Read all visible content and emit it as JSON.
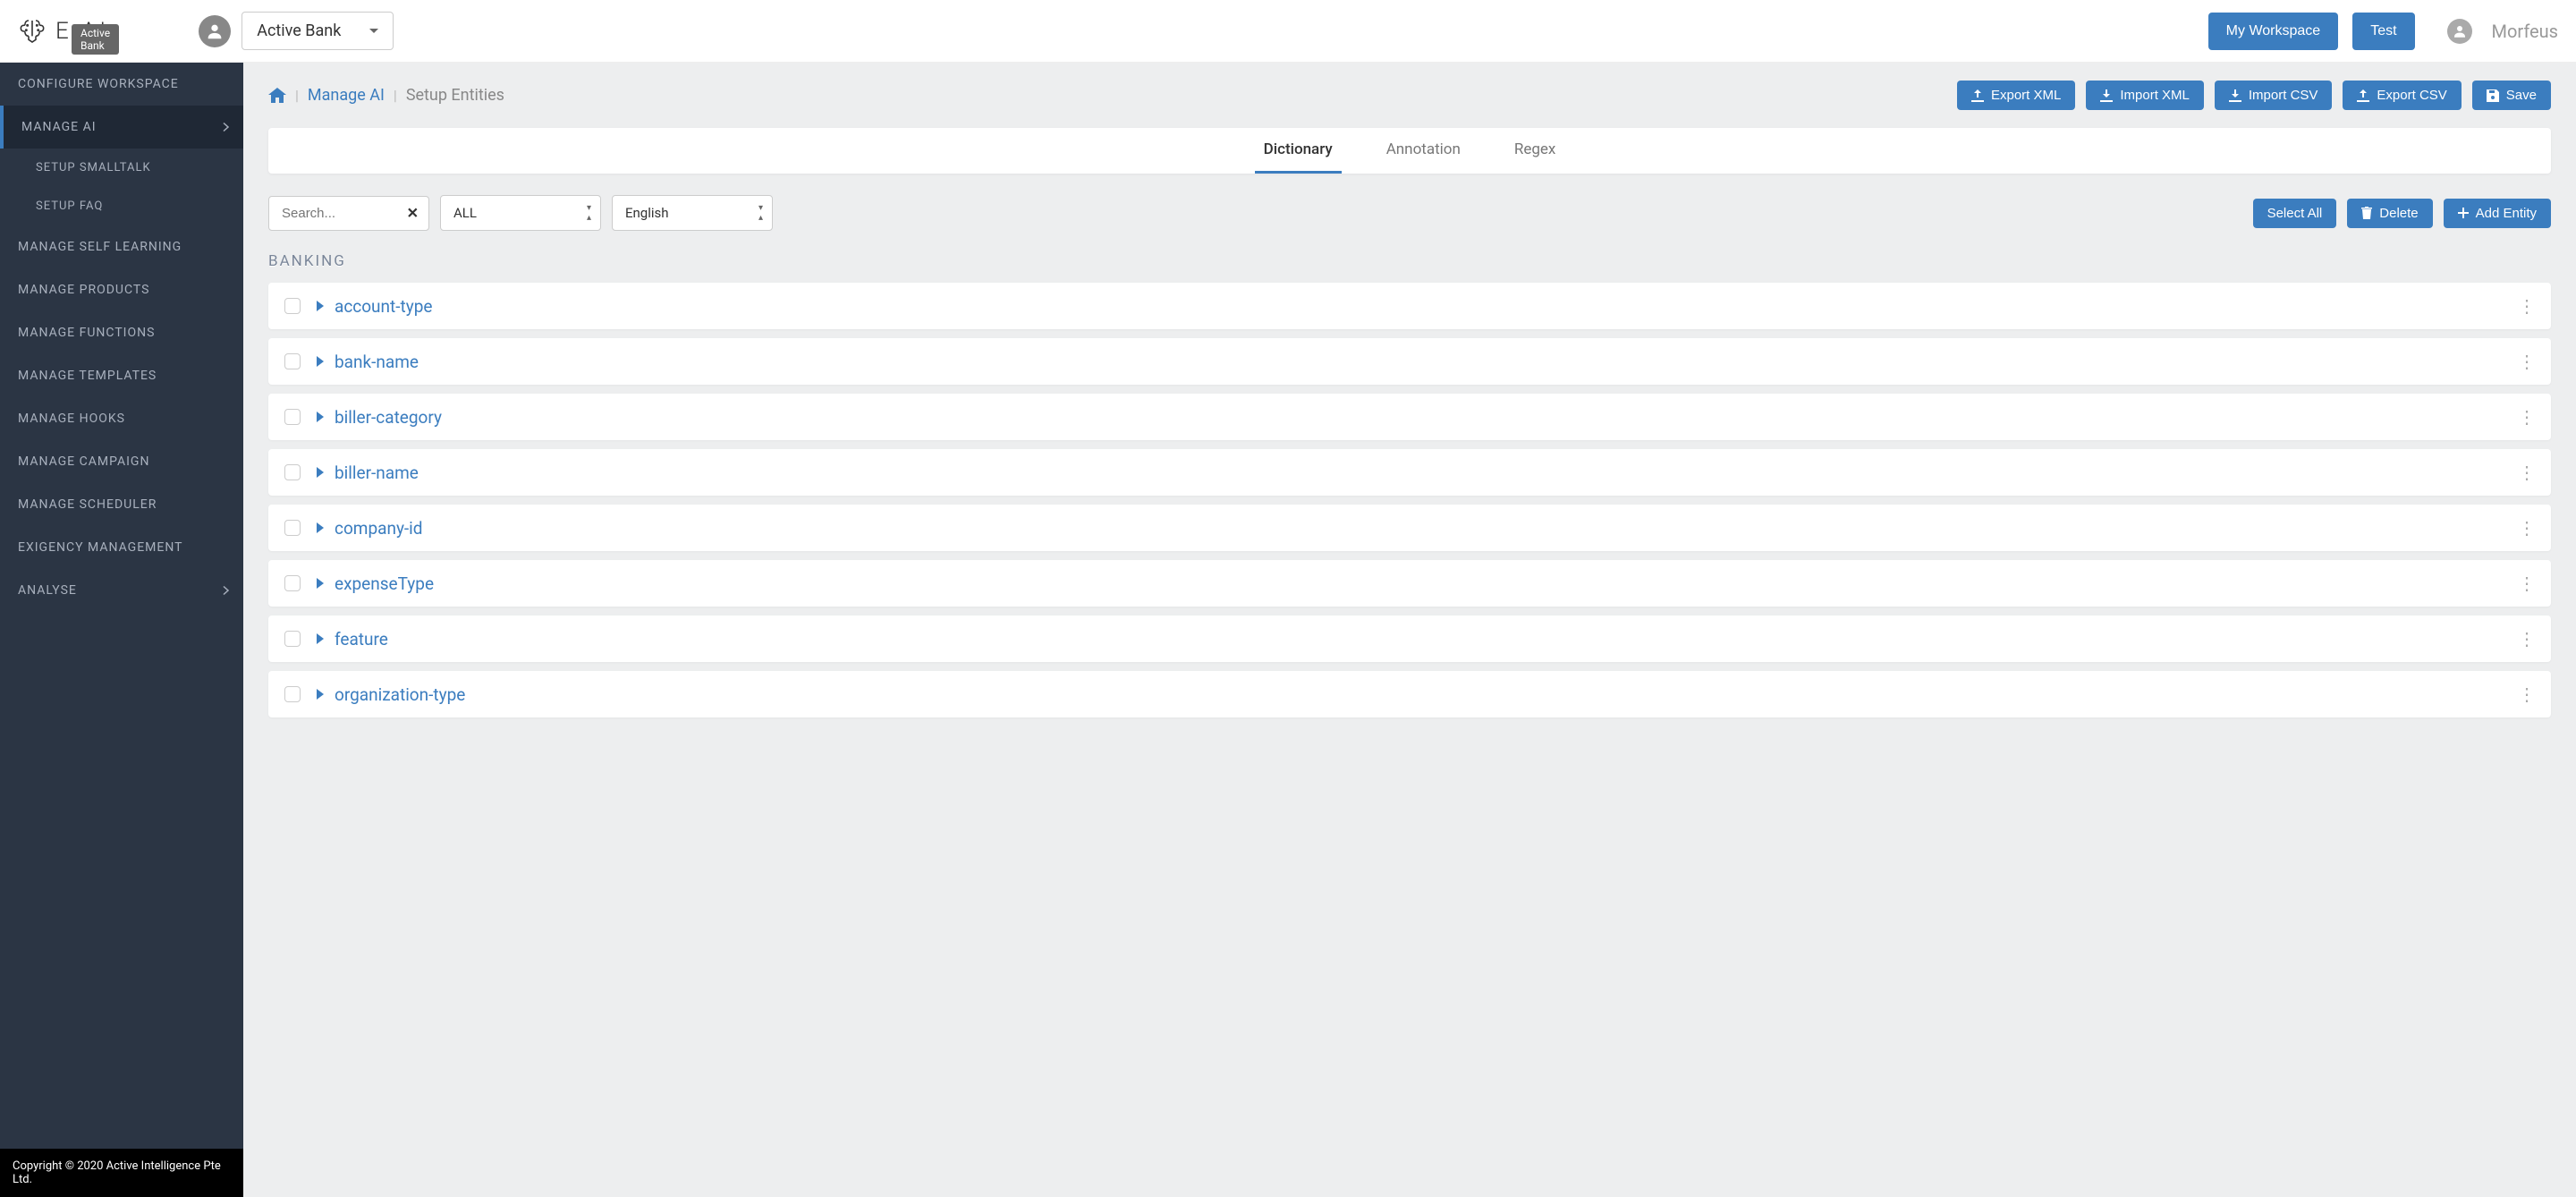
{
  "brand": {
    "text": "E.AI",
    "tooltip": "Active Bank"
  },
  "workspace_selector": {
    "value": "Active Bank"
  },
  "topbar": {
    "my_workspace": "My Workspace",
    "test": "Test",
    "username": "Morfeus"
  },
  "sidebar": {
    "items": [
      {
        "label": "CONFIGURE WORKSPACE",
        "active": false,
        "hasChevron": false
      },
      {
        "label": "MANAGE AI",
        "active": true,
        "hasChevron": true
      },
      {
        "label": "MANAGE SELF LEARNING",
        "active": false,
        "hasChevron": false
      },
      {
        "label": "MANAGE PRODUCTS",
        "active": false,
        "hasChevron": false
      },
      {
        "label": "MANAGE FUNCTIONS",
        "active": false,
        "hasChevron": false
      },
      {
        "label": "MANAGE TEMPLATES",
        "active": false,
        "hasChevron": false
      },
      {
        "label": "MANAGE HOOKS",
        "active": false,
        "hasChevron": false
      },
      {
        "label": "MANAGE CAMPAIGN",
        "active": false,
        "hasChevron": false
      },
      {
        "label": "MANAGE SCHEDULER",
        "active": false,
        "hasChevron": false
      },
      {
        "label": "EXIGENCY MANAGEMENT",
        "active": false,
        "hasChevron": false
      },
      {
        "label": "ANALYSE",
        "active": false,
        "hasChevron": true
      }
    ],
    "subitems": [
      {
        "label": "SETUP SMALLTALK"
      },
      {
        "label": "SETUP FAQ"
      }
    ],
    "footer": "Copyright © 2020 Active Intelligence Pte Ltd."
  },
  "breadcrumb": {
    "manage_ai": "Manage AI",
    "current": "Setup Entities",
    "actions": {
      "export_xml": "Export XML",
      "import_xml": "Import XML",
      "import_csv": "Import CSV",
      "export_csv": "Export CSV",
      "save": "Save"
    }
  },
  "tabs": {
    "dictionary": "Dictionary",
    "annotation": "Annotation",
    "regex": "Regex"
  },
  "filters": {
    "search_placeholder": "Search...",
    "type_select": "ALL",
    "lang_select": "English",
    "select_all": "Select All",
    "delete": "Delete",
    "add_entity": "Add Entity"
  },
  "section": {
    "header": "BANKING"
  },
  "entities": [
    {
      "name": "account-type"
    },
    {
      "name": "bank-name"
    },
    {
      "name": "biller-category"
    },
    {
      "name": "biller-name"
    },
    {
      "name": "company-id"
    },
    {
      "name": "expenseType"
    },
    {
      "name": "feature"
    },
    {
      "name": "organization-type"
    }
  ]
}
